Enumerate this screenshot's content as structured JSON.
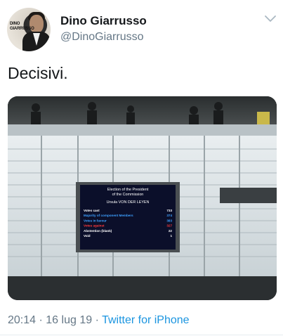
{
  "author": {
    "display_name": "Dino Giarrusso",
    "handle": "@DinoGiarrusso",
    "avatar_text": "DINO GIARRUSSO"
  },
  "tweet": {
    "text": "Decisivi.",
    "time": "20:14",
    "separator": "·",
    "date": "16 lug 19",
    "source": "Twitter for iPhone"
  },
  "photo": {
    "screen": {
      "title_line1": "Election of the President",
      "title_line2": "of the Commission",
      "candidate": "Ursula VON DER LEYEN",
      "rows": [
        {
          "label": "Votes cast",
          "value": "733",
          "color": "#ffffff"
        },
        {
          "label": "Majority of component Members",
          "value": "374",
          "color": "#3da0ff"
        },
        {
          "label": "Votes in favour",
          "value": "383",
          "color": "#3da0ff"
        },
        {
          "label": "Votes against",
          "value": "327",
          "color": "#ff3a3a"
        },
        {
          "label": "Abstention (blank)",
          "value": "22",
          "color": "#ffffff"
        },
        {
          "label": "Void",
          "value": "1",
          "color": "#ffffff"
        }
      ]
    }
  },
  "colors": {
    "link": "#1b95e0",
    "muted": "#657786",
    "text": "#14171a"
  },
  "icons": {
    "menu": "chevron-down-icon"
  }
}
